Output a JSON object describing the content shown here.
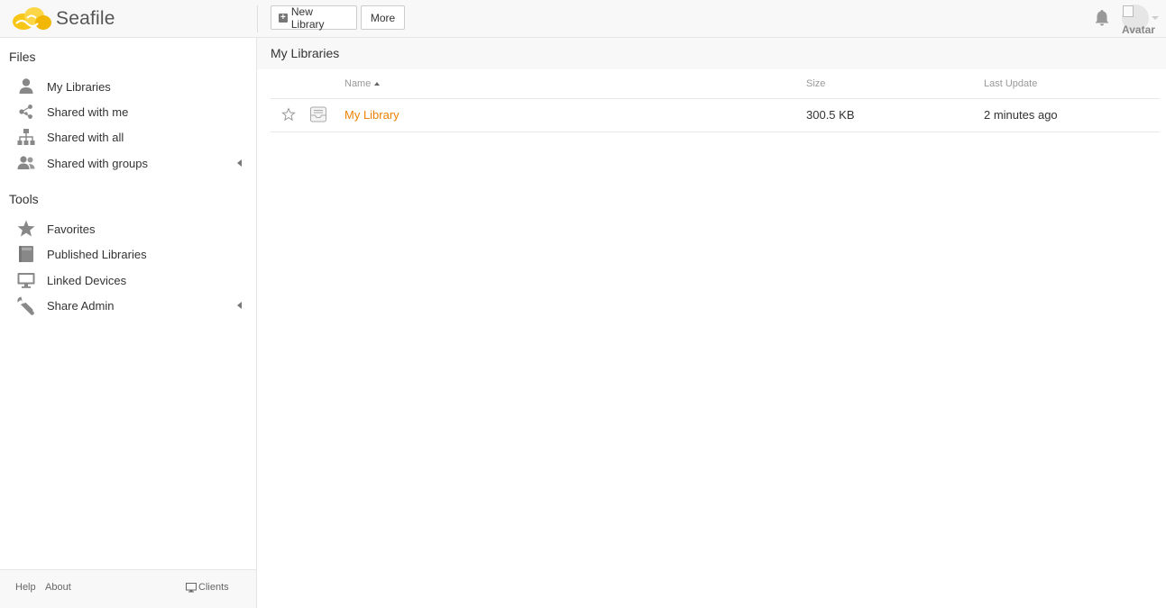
{
  "app": {
    "logo_text": "Seafile"
  },
  "toolbar": {
    "new_library_label": "New Library",
    "more_label": "More"
  },
  "user": {
    "avatar_alt": "Avatar"
  },
  "sidebar": {
    "files_heading": "Files",
    "files_items": [
      {
        "label": "My Libraries",
        "icon": "user-icon"
      },
      {
        "label": "Shared with me",
        "icon": "share-icon"
      },
      {
        "label": "Shared with all",
        "icon": "org-chart-icon"
      },
      {
        "label": "Shared with groups",
        "icon": "group-icon"
      }
    ],
    "tools_heading": "Tools",
    "tools_items": [
      {
        "label": "Favorites",
        "icon": "star-icon"
      },
      {
        "label": "Published Libraries",
        "icon": "book-icon"
      },
      {
        "label": "Linked Devices",
        "icon": "monitor-icon"
      },
      {
        "label": "Share Admin",
        "icon": "wrench-icon"
      }
    ],
    "footer": {
      "help": "Help",
      "about": "About",
      "clients": "Clients"
    }
  },
  "main": {
    "title": "My Libraries",
    "columns": {
      "name": "Name",
      "size": "Size",
      "last_update": "Last Update"
    },
    "rows": [
      {
        "name": "My Library",
        "size": "300.5 KB",
        "last_update": "2 minutes ago"
      }
    ]
  },
  "colors": {
    "accent": "#eb8205",
    "logo_yellow": "#f5c518"
  }
}
